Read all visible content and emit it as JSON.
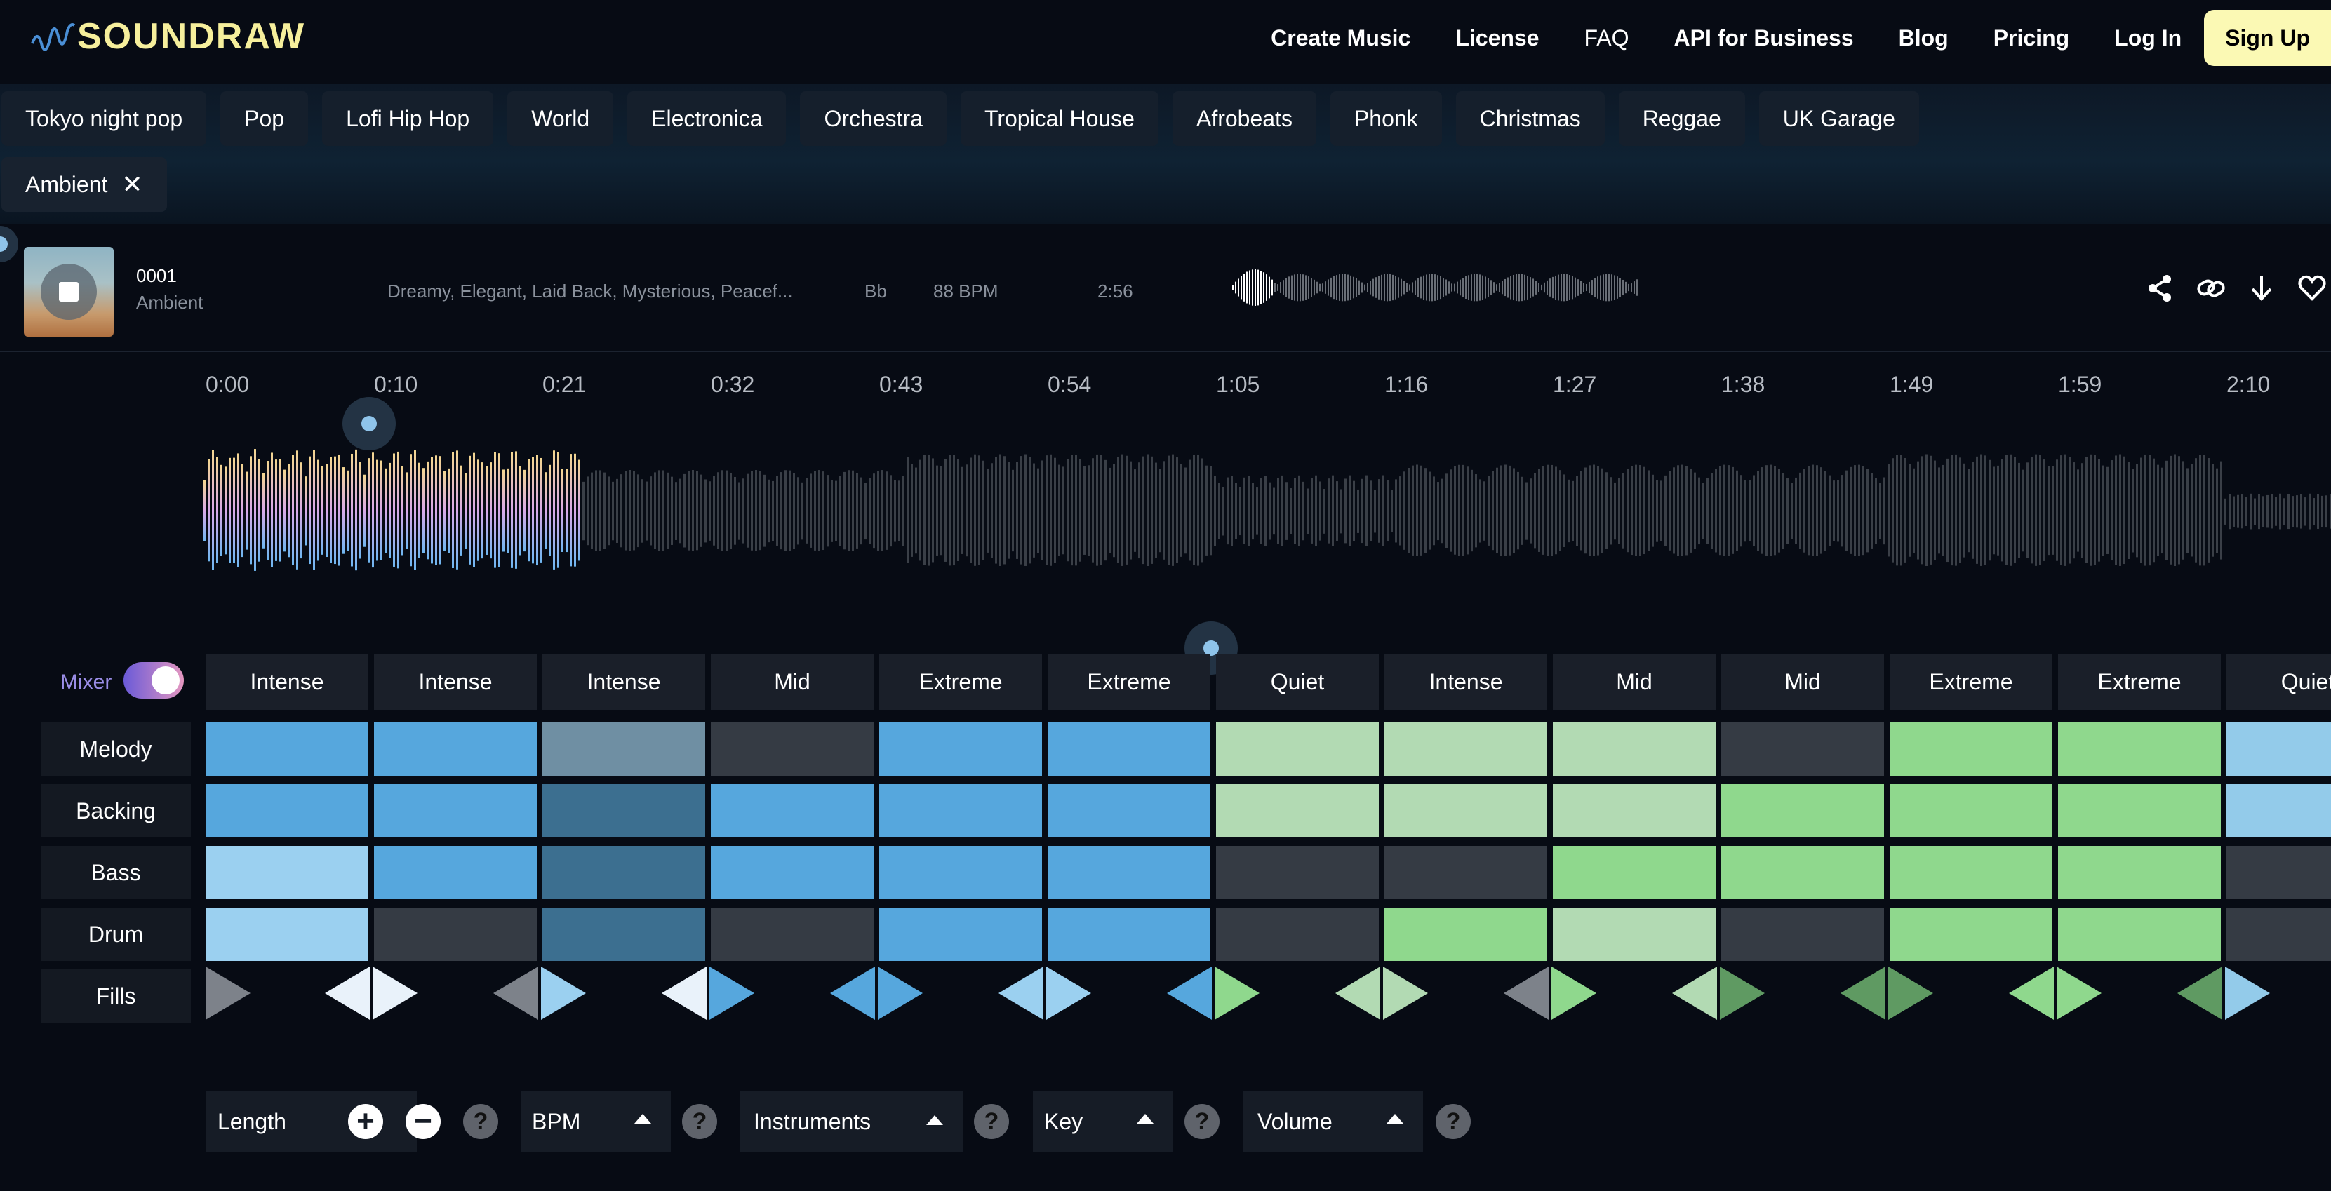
{
  "header": {
    "logo_text": "SOUNDRAW",
    "nav": [
      {
        "label": "Create Music"
      },
      {
        "label": "License"
      },
      {
        "label": "FAQ"
      },
      {
        "label": "API for Business"
      },
      {
        "label": "Blog"
      },
      {
        "label": "Pricing"
      },
      {
        "label": "Log In"
      }
    ],
    "signup_label": "Sign Up"
  },
  "genres": [
    {
      "label": "Tokyo night pop"
    },
    {
      "label": "Pop"
    },
    {
      "label": "Lofi Hip Hop"
    },
    {
      "label": "World"
    },
    {
      "label": "Electronica"
    },
    {
      "label": "Orchestra"
    },
    {
      "label": "Tropical House"
    },
    {
      "label": "Afrobeats"
    },
    {
      "label": "Phonk"
    },
    {
      "label": "Christmas"
    },
    {
      "label": "Reggae"
    },
    {
      "label": "UK Garage"
    }
  ],
  "active_filter": {
    "label": "Ambient",
    "remove_icon": "close-icon"
  },
  "track": {
    "id": "0001",
    "genre": "Ambient",
    "moods": "Dreamy, Elegant, Laid Back, Mysterious, Peacef...",
    "key": "Bb",
    "bpm": "88 BPM",
    "duration": "2:56",
    "actions": [
      "share-icon",
      "link-icon",
      "download-icon",
      "heart-icon"
    ]
  },
  "timeline": {
    "ticks": [
      "0:00",
      "0:10",
      "0:21",
      "0:32",
      "0:43",
      "0:54",
      "1:05",
      "1:16",
      "1:27",
      "1:38",
      "1:49",
      "1:59",
      "2:10"
    ],
    "played_fraction": 0.187
  },
  "mixer": {
    "label": "Mixer",
    "enabled": true,
    "energy": [
      "Intense",
      "Intense",
      "Intense",
      "Mid",
      "Extreme",
      "Extreme",
      "Quiet",
      "Intense",
      "Mid",
      "Mid",
      "Extreme",
      "Extreme",
      "Quiet"
    ],
    "rows": [
      {
        "label": "Melody",
        "cells": [
          "b2",
          "b2",
          "g1",
          "d",
          "b2",
          "b2",
          "g1",
          "g1",
          "g1",
          "d",
          "g2",
          "g2",
          "b3"
        ]
      },
      {
        "label": "Backing",
        "cells": [
          "b2",
          "b2",
          "s",
          "b2",
          "b2",
          "b2",
          "g1",
          "g1",
          "g1",
          "g2",
          "g2",
          "g2",
          "b3"
        ]
      },
      {
        "label": "Bass",
        "cells": [
          "b1",
          "b2",
          "s",
          "b2",
          "b2",
          "b2",
          "d",
          "d",
          "g2",
          "g2",
          "g2",
          "g2",
          "d"
        ]
      },
      {
        "label": "Drum",
        "cells": [
          "b1",
          "d",
          "s",
          "d",
          "b2",
          "b2",
          "d",
          "g2",
          "g1",
          "d",
          "g2",
          "g2",
          "d"
        ]
      }
    ],
    "fills_label": "Fills",
    "colors": {
      "b1": "#9bd0f0",
      "b2": "#56a7dd",
      "b3": "#93cbea",
      "s": "#3c6f90",
      "g1": "#b2dab3",
      "g2": "#8fd88d",
      "d": "#353b44",
      "greyblue": "#6f8fa3"
    }
  },
  "controls": [
    {
      "label": "Length"
    },
    {
      "label": "BPM"
    },
    {
      "label": "Instruments"
    },
    {
      "label": "Key"
    },
    {
      "label": "Volume"
    }
  ]
}
